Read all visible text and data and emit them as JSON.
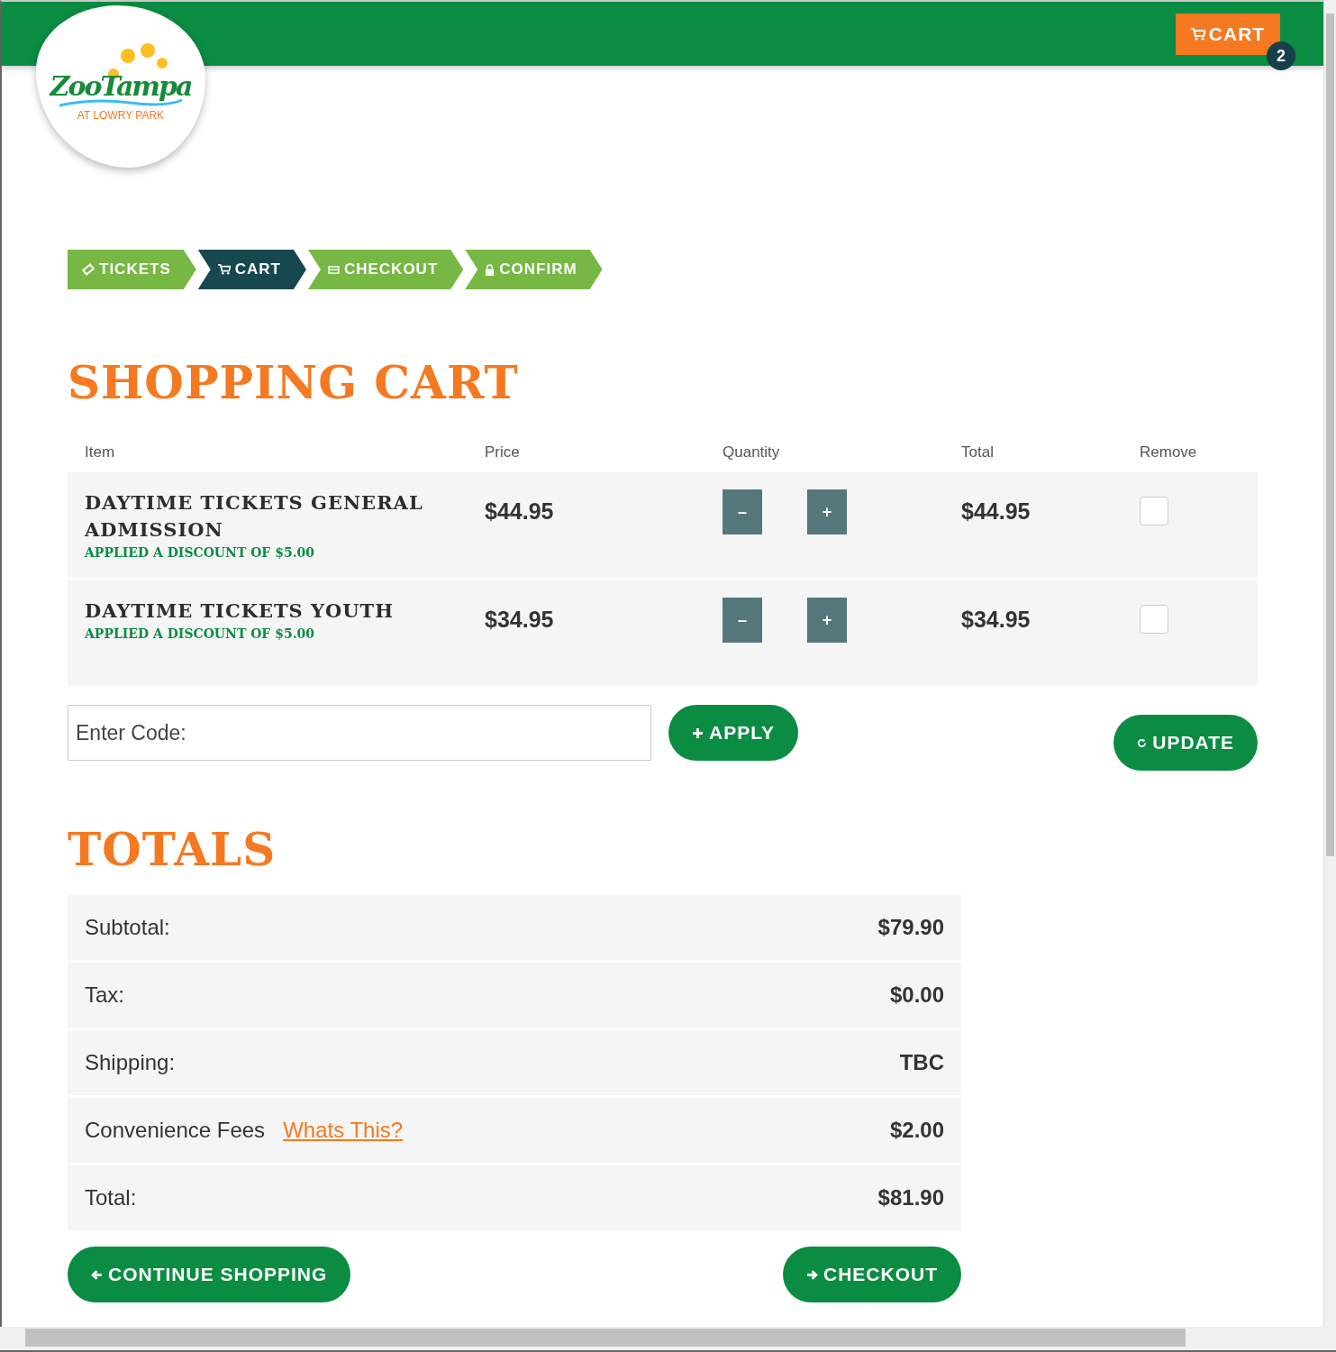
{
  "header": {
    "logo": {
      "name": "ZooTampa",
      "tagline": "AT LOWRY PARK"
    },
    "cart_button": {
      "label": "CART",
      "count": "2"
    }
  },
  "steps": [
    {
      "label": "TICKETS",
      "kind": "tickets",
      "selected": false
    },
    {
      "label": "CART",
      "kind": "cart",
      "selected": true
    },
    {
      "label": "CHECKOUT",
      "kind": "checkout",
      "selected": false
    },
    {
      "label": "CONFIRM",
      "kind": "confirm",
      "selected": false
    }
  ],
  "title": "SHOPPING CART",
  "table": {
    "columns": [
      "Item",
      "Price",
      "Quantity",
      "Total",
      "Remove"
    ],
    "rows": [
      {
        "item": "DAYTIME TICKETS GENERAL ADMISSION",
        "discount": "APPLIED A DISCOUNT OF $5.00",
        "price": "$44.95",
        "minus": "–",
        "plus": "+",
        "total": "$44.95",
        "remove": false
      },
      {
        "item": "DAYTIME TICKETS YOUTH",
        "discount": "APPLIED A DISCOUNT OF $5.00",
        "price": "$34.95",
        "minus": "–",
        "plus": "+",
        "total": "$34.95",
        "remove": false
      }
    ]
  },
  "code_field": {
    "placeholder": "Enter Code:"
  },
  "apply_button": "APPLY",
  "update_button": "UPDATE",
  "totals": {
    "title": "TOTALS",
    "rows": [
      {
        "label": "Subtotal:",
        "value": "$79.90"
      },
      {
        "label": "Tax:",
        "value": "$0.00"
      },
      {
        "label": "Shipping:",
        "value": "TBC"
      },
      {
        "label": "Convenience Fees",
        "link": "Whats This?",
        "value": "$2.00"
      },
      {
        "label": "Total:",
        "value": "$81.90"
      }
    ]
  },
  "continue_button": "CONTINUE SHOPPING",
  "checkout_button": "CHECKOUT"
}
